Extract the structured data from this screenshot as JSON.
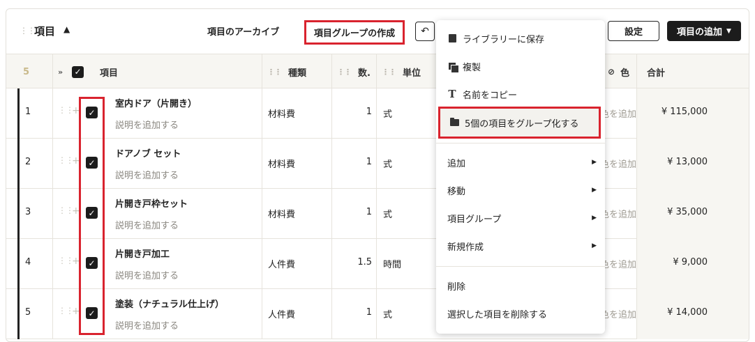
{
  "header": {
    "title": "項目",
    "archive_label": "項目のアーカイブ",
    "group_create_label": "項目グループの作成",
    "settings_label": "設定",
    "add_label": "項目の追加"
  },
  "table": {
    "selected_count": "5",
    "columns": {
      "item": "項目",
      "kind": "種類",
      "qty": "数.",
      "unit": "単位",
      "color": "色",
      "total": "合計"
    },
    "rows": [
      {
        "num": "1",
        "name": "室内ドア（片開き）",
        "desc": "説明を追加する",
        "kind": "材料費",
        "qty": "1",
        "unit": "式",
        "color_frag": "色を追加",
        "total": "¥ 115,000"
      },
      {
        "num": "2",
        "name": "ドアノブ セット",
        "desc": "説明を追加する",
        "kind": "材料費",
        "qty": "1",
        "unit": "式",
        "color_frag": "色を追加",
        "total": "¥ 13,000"
      },
      {
        "num": "3",
        "name": "片開き戸枠セット",
        "desc": "説明を追加する",
        "kind": "材料費",
        "qty": "1",
        "unit": "式",
        "color_frag": "色を追加",
        "total": "¥ 35,000"
      },
      {
        "num": "4",
        "name": "片開き戸加工",
        "desc": "説明を追加する",
        "kind": "人件費",
        "qty": "1.5",
        "unit": "時間",
        "color_frag": "色を追加",
        "total": "¥ 9,000"
      },
      {
        "num": "5",
        "name": "塗装（ナチュラル仕上げ）",
        "desc": "説明を追加する",
        "kind": "人件費",
        "qty": "1",
        "unit": "式",
        "color_frag": "色を追加",
        "total": "¥ 14,000"
      }
    ]
  },
  "menu": {
    "save_library": "ライブラリーに保存",
    "duplicate": "複製",
    "copy_name": "名前をコピー",
    "group_items": "5個の項目をグループ化する",
    "add": "追加",
    "move": "移動",
    "item_group": "項目グループ",
    "new_create": "新規作成",
    "delete": "削除",
    "delete_selected": "選択した項目を削除する"
  }
}
